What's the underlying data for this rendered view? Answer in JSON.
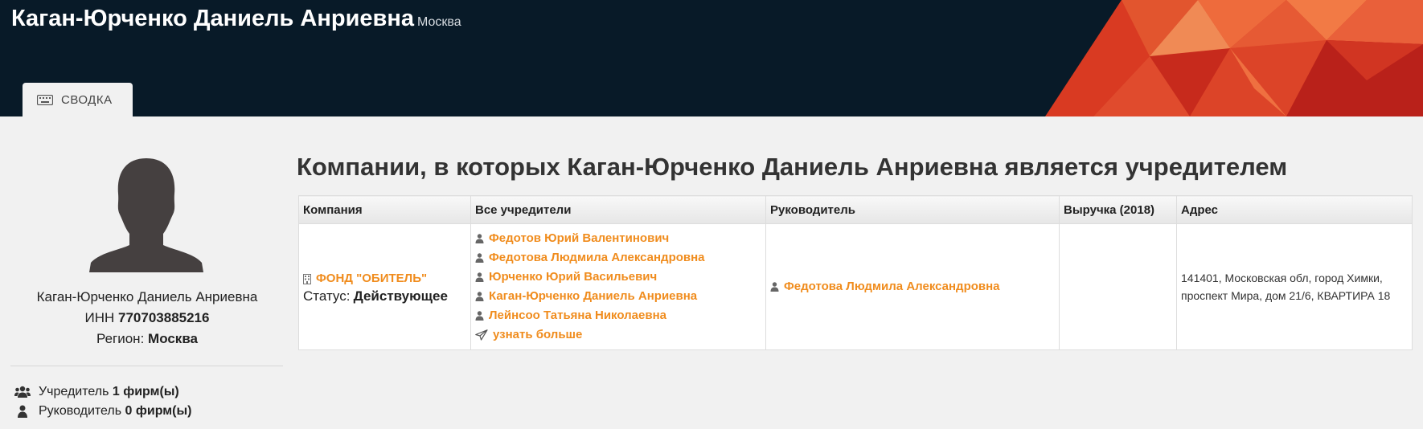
{
  "header": {
    "person_name": "Каган-Юрченко Даниель Анриевна",
    "city": "Москва"
  },
  "tabs": [
    {
      "label": "СВОДКА",
      "icon": "keyboard-icon",
      "active": true
    }
  ],
  "sidebar": {
    "name": "Каган-Юрченко Даниель Анриевна",
    "inn_label": "ИНН",
    "inn": "770703885216",
    "region_label": "Регион:",
    "region": "Москва",
    "founder_label": "Учредитель",
    "founder_count": "1 фирм(ы)",
    "manager_label": "Руководитель",
    "manager_count": "0 фирм(ы)"
  },
  "main": {
    "title": "Компании, в которых Каган-Юрченко Даниель Анриевна является учредителем",
    "table": {
      "columns": [
        "Компания",
        "Все учредители",
        "Руководитель",
        "Выручка (2018)",
        "Адрес"
      ],
      "rows": [
        {
          "company": "ФОНД \"ОБИТЕЛЬ\"",
          "status_label": "Статус:",
          "status": "Действующее",
          "founders": [
            "Федотов Юрий Валентинович",
            "Федотова Людмила Александровна",
            "Юрченко Юрий Васильевич",
            "Каган-Юрченко Даниель Анриевна",
            "Лейнсоо Татьяна Николаевна"
          ],
          "more_label": "узнать больше",
          "manager": "Федотова Людмила Александровна",
          "revenue": "",
          "address": "141401, Московская обл, город Химки, проспект Мира, дом 21/6, КВАРТИРА 18"
        }
      ]
    }
  },
  "colors": {
    "header_bg": "#081a28",
    "link": "#f08c1d",
    "page_bg": "#f1f1f1"
  }
}
